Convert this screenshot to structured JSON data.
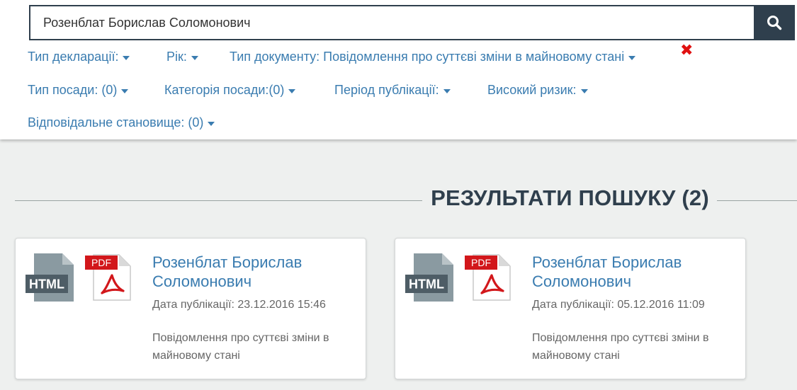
{
  "search": {
    "value": "Розенблат Борислав Соломонович",
    "button_icon": "search-icon"
  },
  "filters": {
    "declaration_type": "Тип декларації:",
    "year": "Рік:",
    "document_type": "Тип документу: Повідомлення про суттєві зміни в майновому стані",
    "clear_symbol": "✖",
    "position_type": "Тип посади: (0)",
    "position_category": "Категорія посади:(0)",
    "publication_period": "Період публікації:",
    "high_risk": "Високий ризик:",
    "responsible_position": "Відповідальне становище: (0)"
  },
  "results": {
    "title": "РЕЗУЛЬТАТИ ПОШУКУ (2)"
  },
  "icons": {
    "html_label": "HTML",
    "pdf_label": "PDF"
  },
  "cards": [
    {
      "name": "Розенблат Борислав Соломонович",
      "date": "Дата публікації: 23.12.2016 15:46",
      "type": "Повідомлення про суттєві зміни в майновому стані"
    },
    {
      "name": "Розенблат Борислав Соломонович",
      "date": "Дата публікації: 05.12.2016 11:09",
      "type": "Повідомлення про суттєві зміни в майновому стані"
    }
  ],
  "colors": {
    "link": "#3a7cb0",
    "dark": "#2f3f4d",
    "clear": "#e01010",
    "pdf_red": "#d2171b",
    "html_gray": "#8a9aa1"
  }
}
